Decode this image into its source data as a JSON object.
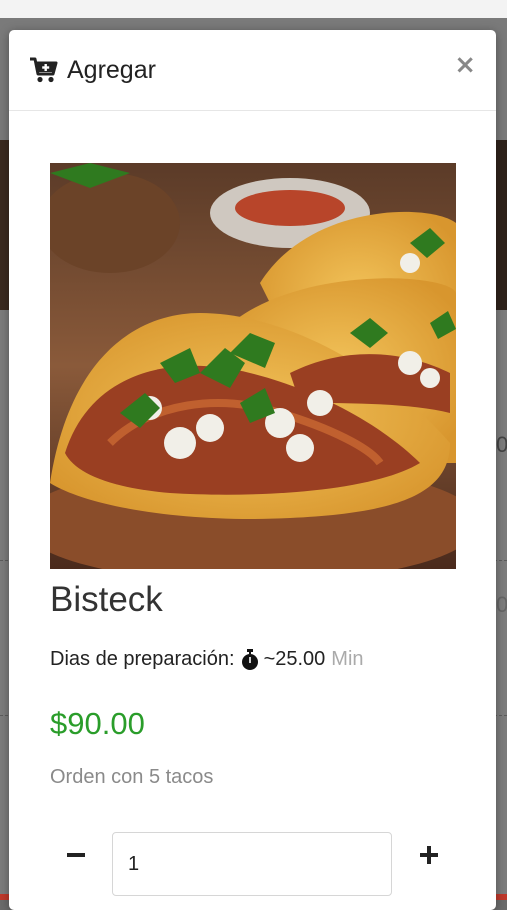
{
  "modal": {
    "title": "Agregar",
    "close_label": "×"
  },
  "product": {
    "name": "Bisteck",
    "prep_label": "Dias de preparación:",
    "prep_value": "~25.00",
    "prep_unit": "Min",
    "price": "$90.00",
    "description": "Orden con 5 tacos",
    "quantity": "1"
  },
  "background": {
    "stub_a": "0",
    "stub_b": "0"
  },
  "icons": {
    "cart": "cart-plus-icon",
    "close": "close-icon",
    "stopwatch": "stopwatch-icon",
    "minus": "minus-icon",
    "plus": "plus-icon"
  },
  "colors": {
    "price": "#2a9d2a",
    "muted": "#8a8a8a",
    "overlay": "#6b6b6b"
  }
}
